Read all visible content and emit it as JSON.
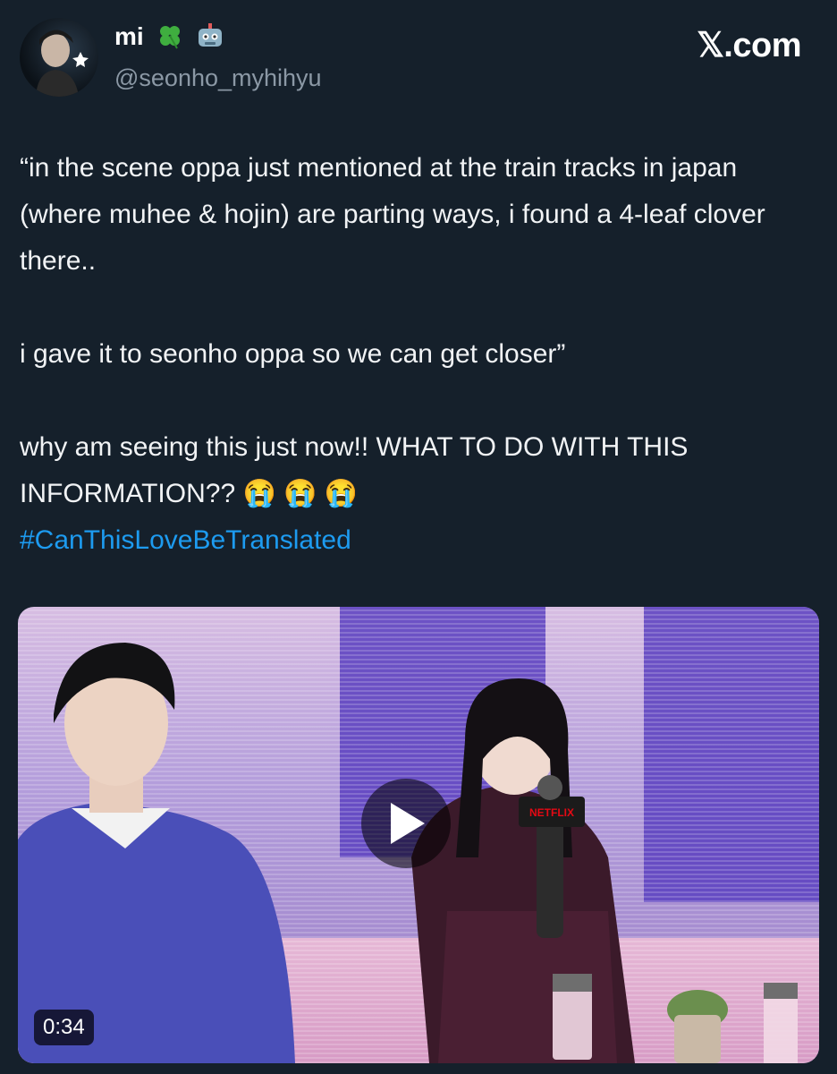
{
  "author": {
    "display_name": "mi",
    "handle": "@seonho_myhihyu",
    "name_emoji": [
      "clover-icon",
      "robot-icon"
    ]
  },
  "brand": "𝕏.com",
  "tweet": {
    "paragraph1": "“in the scene oppa just mentioned at the train tracks in japan (where muhee & hojin) are parting ways, i found a 4-leaf clover there..",
    "paragraph2": "i gave it to seonho oppa so we can get closer”",
    "paragraph3": "why am seeing this just now!! WHAT TO DO WITH THIS INFORMATION??",
    "emojis": [
      "😭",
      "😭",
      "😭"
    ],
    "hashtag": "#CanThisLoveBeTranslated"
  },
  "media": {
    "duration": "0:34",
    "mic_label": "NETFLIX"
  },
  "colors": {
    "background": "#15202b",
    "hashtag": "#1d9bf0",
    "secondary_text": "#8b98a5"
  }
}
